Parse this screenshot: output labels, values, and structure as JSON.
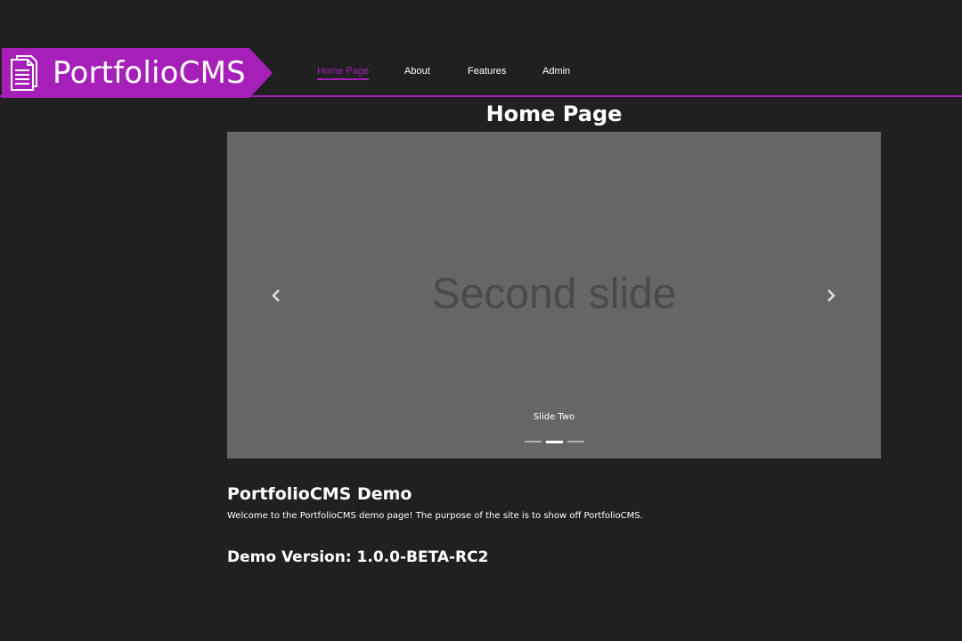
{
  "colors": {
    "background": "#202020",
    "accent": "#a61fb8",
    "carousel_bg": "#666666",
    "slide_text": "#4a4a4a"
  },
  "header": {
    "brand_name": "PortfolioCMS",
    "brand_icon": "document-icon",
    "nav": [
      {
        "label": "Home Page",
        "active": true
      },
      {
        "label": "About",
        "active": false
      },
      {
        "label": "Features",
        "active": false
      },
      {
        "label": "Admin",
        "active": false
      }
    ]
  },
  "main": {
    "page_title": "Home Page",
    "carousel": {
      "slide_text": "Second slide",
      "caption": "Slide Two",
      "prev_icon": "chevron-left-icon",
      "next_icon": "chevron-right-icon",
      "slide_count": 3,
      "active_index": 1
    },
    "demo_title": "PortfolioCMS Demo",
    "demo_text": "Welcome to the PortfolioCMS demo page! The purpose of the site is to show off PortfolioCMS.",
    "demo_version": "Demo Version: 1.0.0-BETA-RC2"
  }
}
